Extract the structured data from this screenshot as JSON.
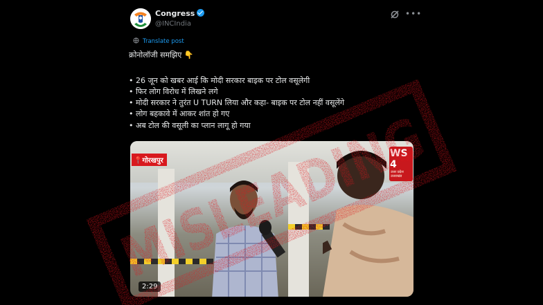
{
  "post": {
    "author": "Congress",
    "handle": "@INCIndia",
    "translate_label": "Translate post",
    "lines": [
      "क्रोनोलॉजी समझिए 👇",
      "• 26 जून को खबर आई कि मोदी सरकार बाइक पर टोल वसूलेगी",
      "• फिर लोग विरोध में लिखने लगे",
      "• मोदी सरकार ने तुरंत U TURN लिया और कहा- बाइक पर टोल नहीं वसूलेंगे",
      "• लोग बहकावे में आकर शांत हो गए",
      "• अब टोल की वसूली का प्लान लागू हो गया"
    ]
  },
  "video": {
    "location_tag": "गोरखपुर",
    "channel_logo_text": "WS 4",
    "channel_logo_small": "उत्तर प्रदेश उत्तराखंड",
    "duration": "2:29"
  },
  "overlay": {
    "stamp_text": "MISLEADING",
    "stamp_color": "#e0141b"
  },
  "colors": {
    "background": "#000000",
    "link": "#1d9bf0",
    "verified": "#1d9bf0",
    "location_tag_bg": "#d8191e"
  },
  "icons": [
    "congress-logo-avatar",
    "verified-badge-icon",
    "grok-icon",
    "more-icon",
    "globe-icon"
  ]
}
